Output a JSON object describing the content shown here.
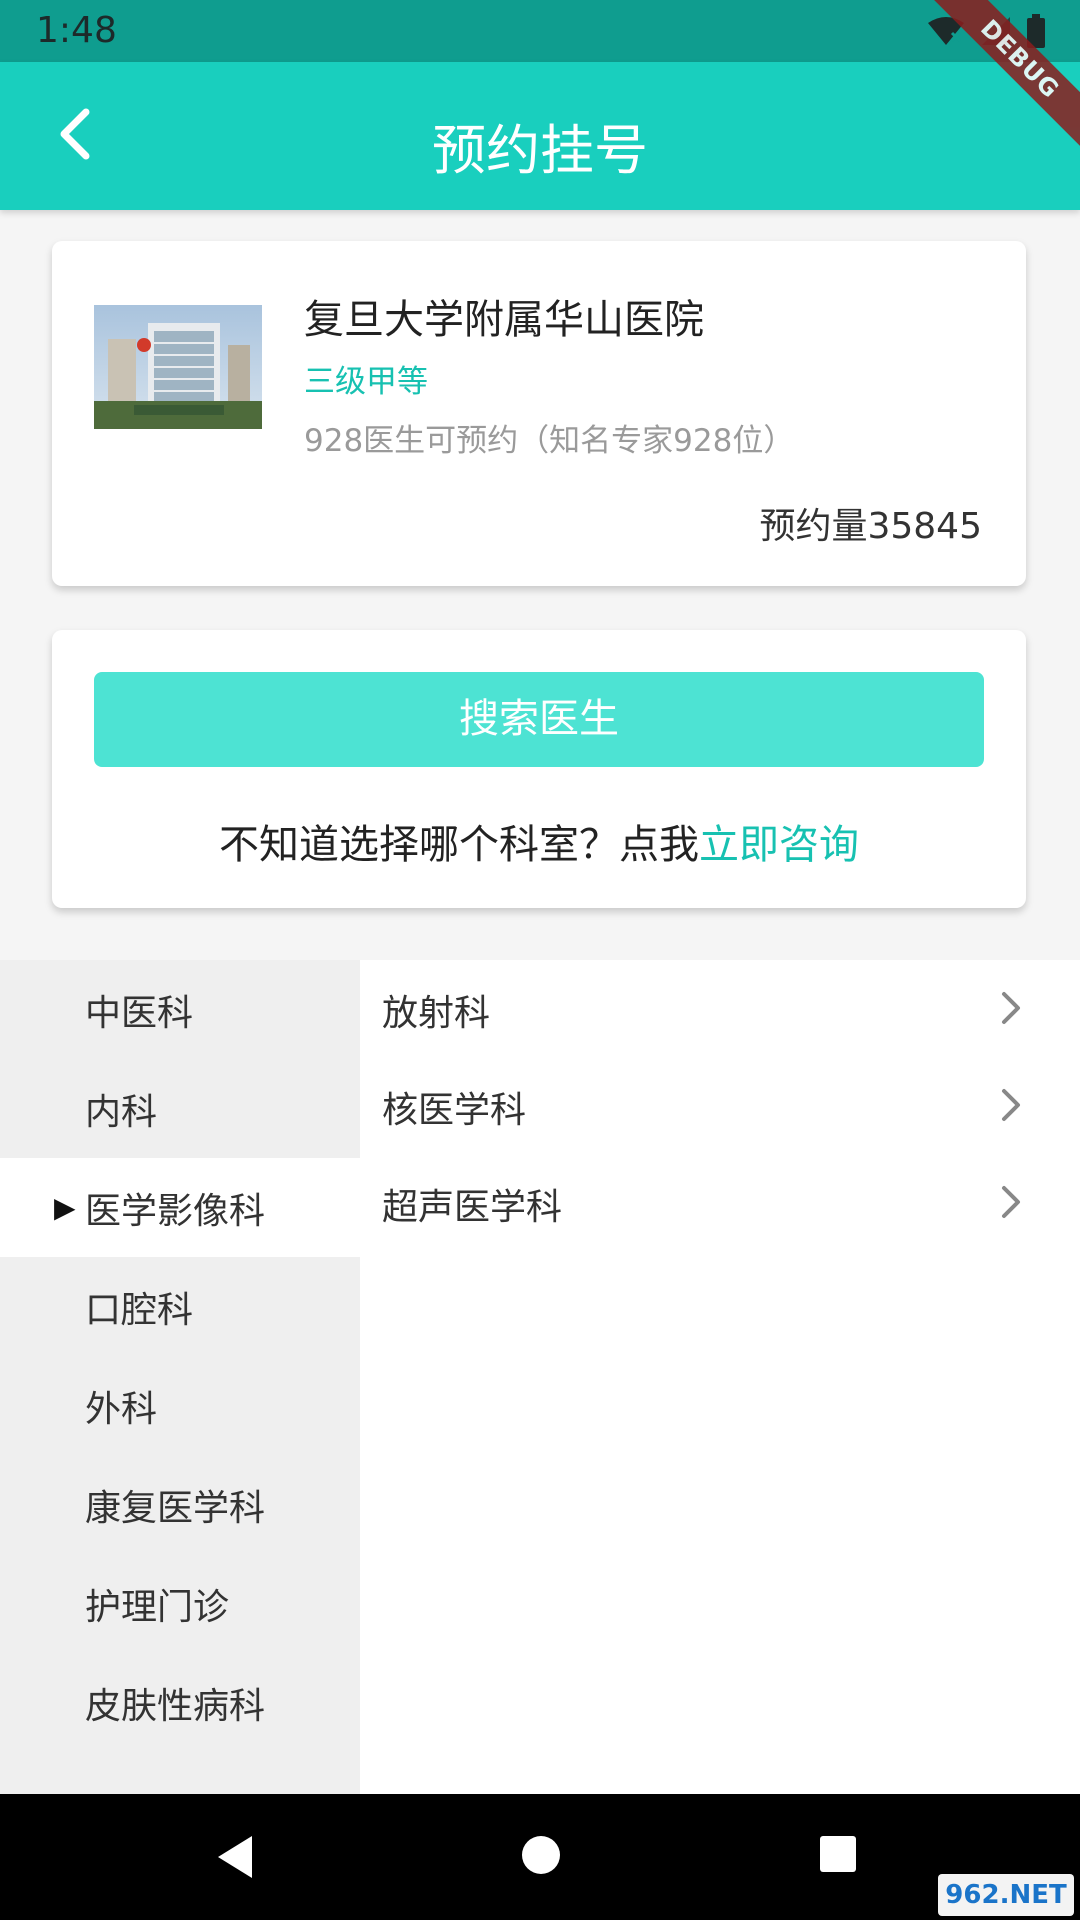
{
  "status_bar": {
    "time": "1:48",
    "icons": [
      "wifi-icon",
      "signal-icon",
      "battery-icon"
    ],
    "color": "#0f9d8f"
  },
  "debug_banner": "DEBUG",
  "app_bar": {
    "title": "预约挂号",
    "back_icon": "chevron-left-icon",
    "color": "#19cfbe"
  },
  "hospital": {
    "name": "复旦大学附属华山医院",
    "level": "三级甲等",
    "doctors": "928医生可预约（知名专家928位）",
    "booking_count": "预约量35845",
    "level_color": "#17c1b1"
  },
  "search": {
    "button_label": "搜索医生",
    "consult_prefix": "不知道选择哪个科室？点我",
    "consult_link": "立即咨询",
    "button_color": "#4de3d3"
  },
  "departments": {
    "categories": [
      {
        "label": "中医科",
        "selected": false
      },
      {
        "label": "内科",
        "selected": false
      },
      {
        "label": "医学影像科",
        "selected": true
      },
      {
        "label": "口腔科",
        "selected": false
      },
      {
        "label": "外科",
        "selected": false
      },
      {
        "label": "康复医学科",
        "selected": false
      },
      {
        "label": "护理门诊",
        "selected": false
      },
      {
        "label": "皮肤性病科",
        "selected": false
      }
    ],
    "selected_marker": "▶",
    "sub_departments": [
      "放射科",
      "核医学科",
      "超声医学科"
    ]
  },
  "nav_bar": {
    "icons": [
      "back-triangle-icon",
      "home-circle-icon",
      "recents-square-icon"
    ]
  },
  "watermark": "962.NET"
}
